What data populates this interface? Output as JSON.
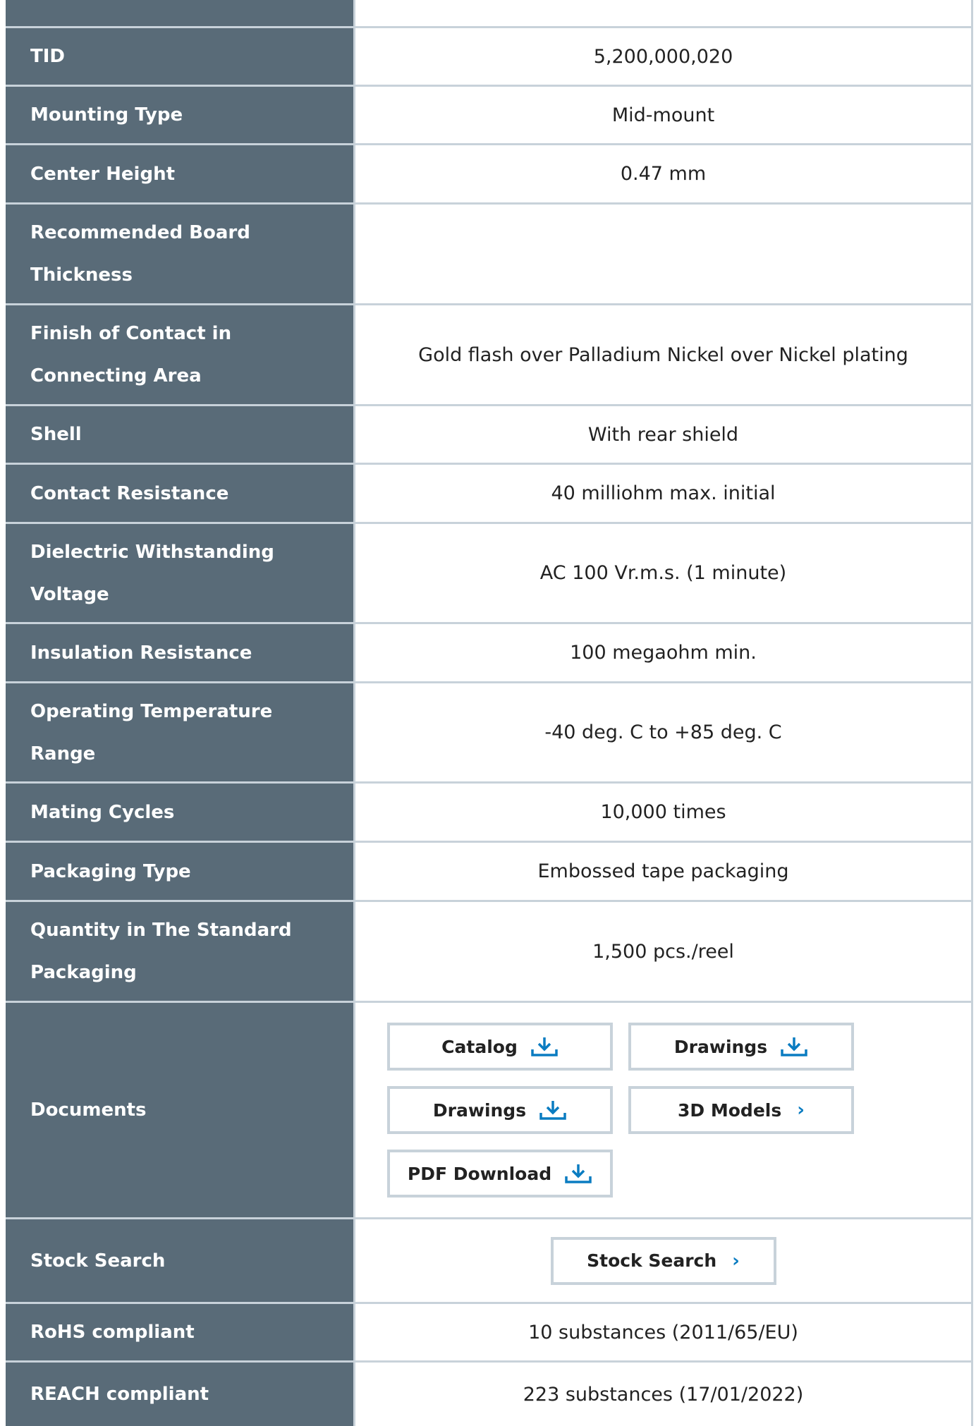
{
  "rows": [
    {
      "label": "TID",
      "value": "5,200,000,020"
    },
    {
      "label": "Mounting Type",
      "value": "Mid-mount"
    },
    {
      "label": "Center Height",
      "value": "0.47 mm"
    },
    {
      "label": "Recommended Board Thickness",
      "value": ""
    },
    {
      "label": "Finish of Contact in Connecting Area",
      "value": "Gold flash over Palladium Nickel over Nickel plating"
    },
    {
      "label": "Shell",
      "value": "With rear shield"
    },
    {
      "label": "Contact Resistance",
      "value": "40 milliohm max. initial"
    },
    {
      "label": "Dielectric Withstanding Voltage",
      "value": "AC 100 Vr.m.s. (1 minute)"
    },
    {
      "label": "Insulation Resistance",
      "value": "100 megaohm min."
    },
    {
      "label": "Operating Temperature Range",
      "value": "-40 deg. C to +85 deg. C"
    },
    {
      "label": "Mating Cycles",
      "value": "10,000 times"
    },
    {
      "label": "Packaging Type",
      "value": "Embossed tape packaging"
    },
    {
      "label": "Quantity in The Standard Packaging",
      "value": "1,500 pcs./reel"
    }
  ],
  "documents": {
    "label": "Documents",
    "buttons": [
      {
        "label": "Catalog",
        "icon": "download-icon"
      },
      {
        "label": "Drawings",
        "icon": "download-icon"
      },
      {
        "label": "Drawings",
        "icon": "download-icon"
      },
      {
        "label": "3D Models",
        "icon": "chevron-right-icon"
      },
      {
        "label": "PDF Download",
        "icon": "download-icon"
      }
    ]
  },
  "stock": {
    "label": "Stock Search",
    "button": "Stock Search"
  },
  "compliance": [
    {
      "label": "RoHS compliant",
      "value": "10 substances (2011/65/EU)"
    },
    {
      "label": "REACH compliant",
      "value": "223 substances (17/01/2022)"
    }
  ],
  "colors": {
    "label_bg": "#596b78",
    "border": "#c8d2da",
    "accent": "#0a7cc1"
  }
}
